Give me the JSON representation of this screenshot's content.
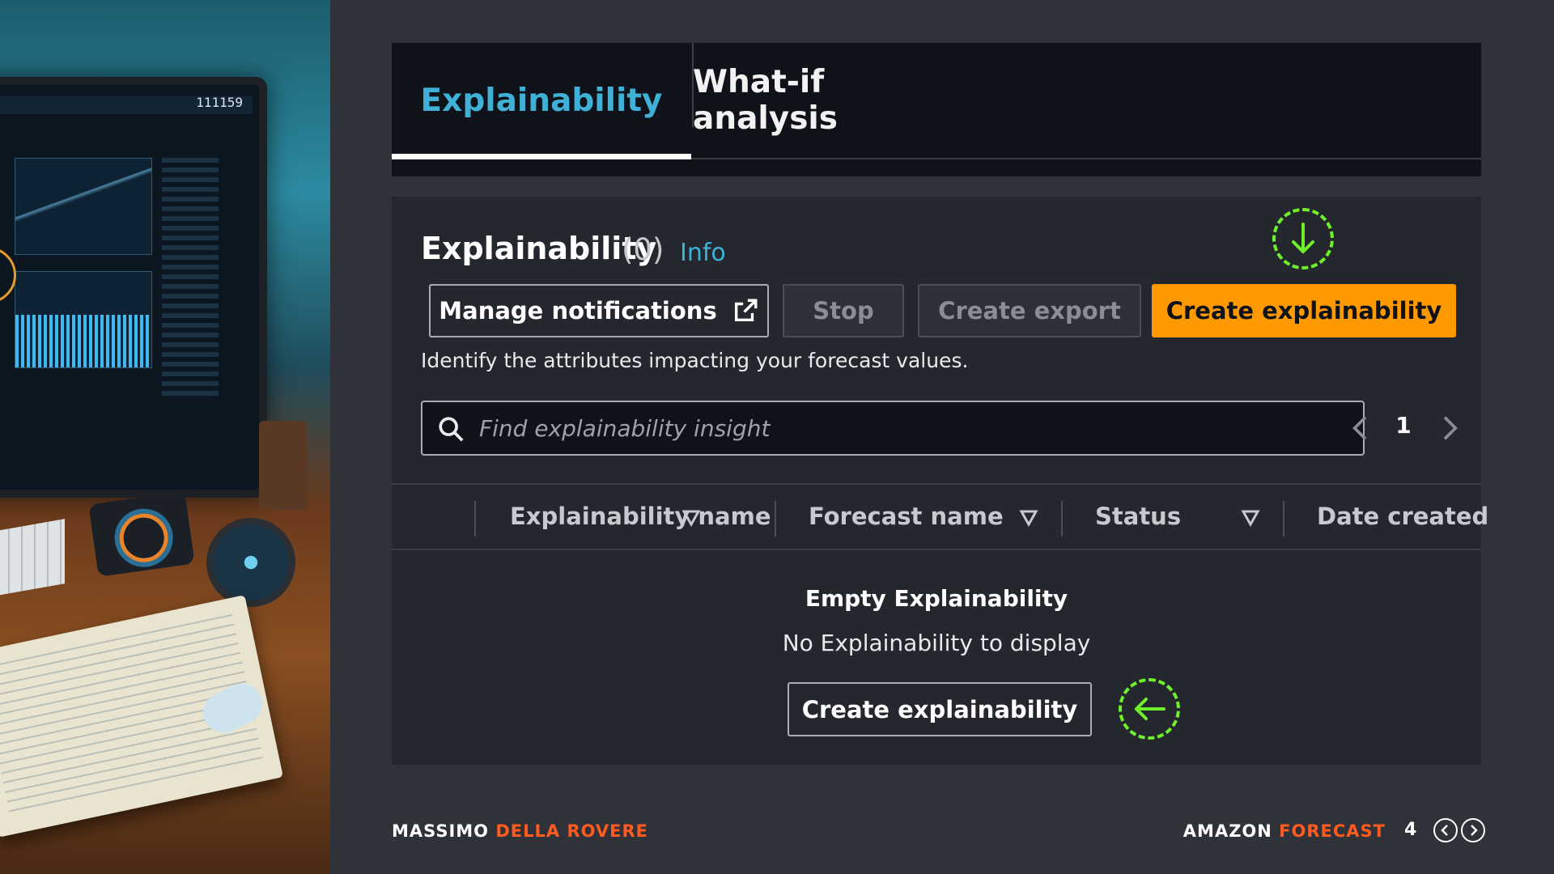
{
  "illustration": {
    "screen_readout": "111159"
  },
  "tabs": [
    {
      "label": "Explainability",
      "active": true
    },
    {
      "label": "What-if analysis",
      "active": false
    }
  ],
  "panel": {
    "title": "Explainability",
    "count": "(0)",
    "info_link": "Info",
    "description": "Identify the attributes impacting your forecast values.",
    "buttons": {
      "manage": "Manage notifications",
      "stop": "Stop",
      "export": "Create export",
      "create": "Create explainability"
    },
    "search": {
      "placeholder": "Find explainability insight",
      "value": ""
    },
    "pagination": {
      "page": "1"
    },
    "table": {
      "columns": [
        "Explainability name",
        "Forecast name",
        "Status",
        "Date created"
      ]
    },
    "empty_state": {
      "title": "Empty Explainability",
      "message": "No Explainability to display",
      "button": "Create explainability"
    }
  },
  "footer": {
    "author_first": "MASSIMO",
    "author_last": "DELLA ROVERE",
    "product_first": "AMAZON",
    "product_last": "FORECAST",
    "page": "4"
  },
  "colors": {
    "background": "#2f3238",
    "panel": "#24272d",
    "tab_bar": "#0f1218",
    "active_tab": "#3fb0d6",
    "primary_button": "#ff9900",
    "hint_marker": "#6ef02a",
    "footer_accent": "#ff5a1f"
  },
  "icons": {
    "external_link": "external-link-icon",
    "search": "search-icon",
    "pager_prev": "chevron-left-icon",
    "pager_next": "chevron-right-icon",
    "sort": "sort-down-icon",
    "hint_down": "arrow-down-icon",
    "hint_left": "arrow-left-icon"
  }
}
